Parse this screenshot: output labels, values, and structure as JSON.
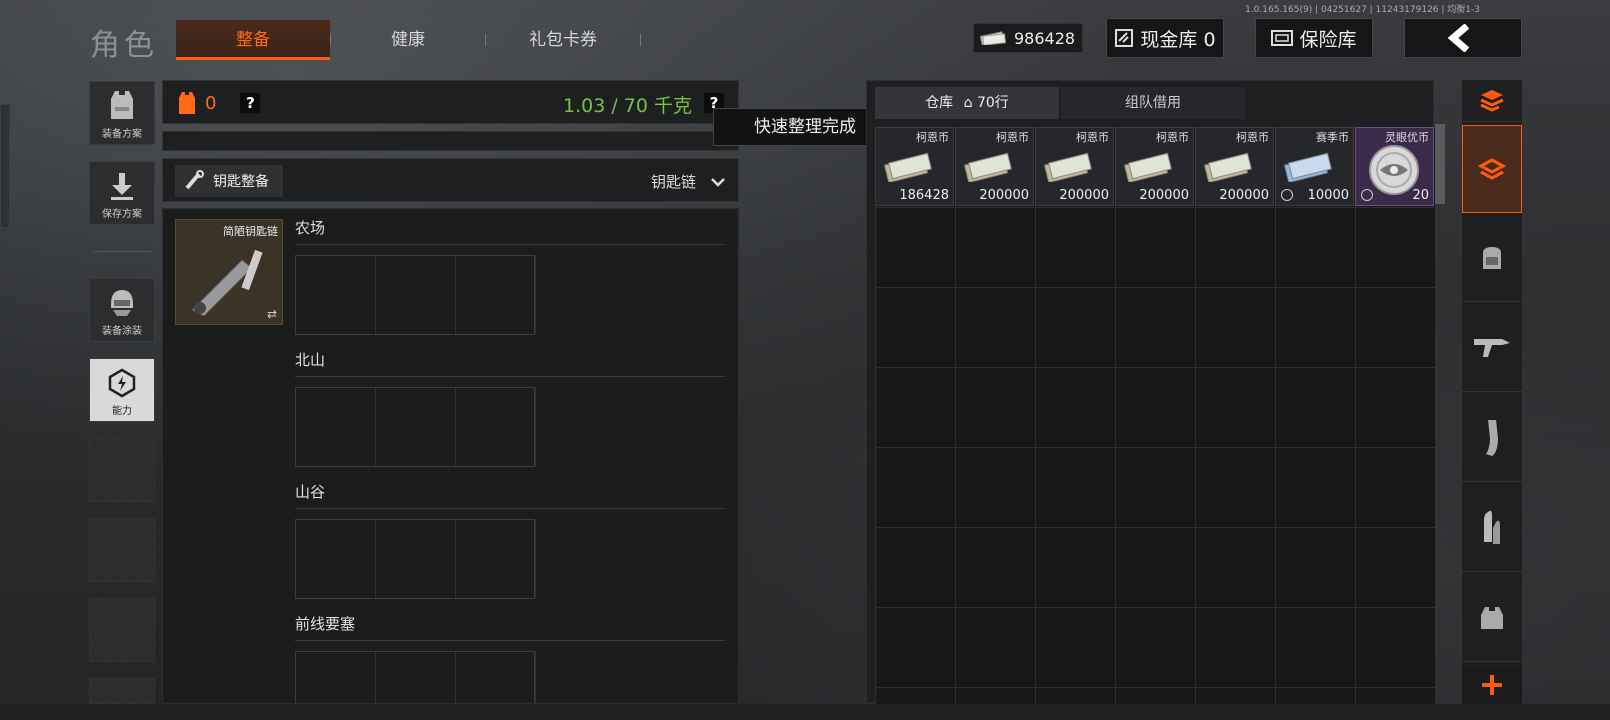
{
  "version": "1.0.165.165(9) | 04251627 | 11243179126 | 均衡1-3",
  "page_title": "角色",
  "tabs": [
    {
      "label": "整备",
      "active": true
    },
    {
      "label": "健康",
      "active": false
    },
    {
      "label": "礼包卡券",
      "active": false
    }
  ],
  "header": {
    "money": "986428",
    "cash_vault": "现金库 0",
    "safe_vault": "保险库"
  },
  "sidebar": {
    "items": [
      {
        "label": "装备方案",
        "icon": "vest-icon"
      },
      {
        "label": "保存方案",
        "icon": "download-icon"
      },
      {
        "label": "装备涂装",
        "icon": "helmet-icon"
      },
      {
        "label": "能力",
        "icon": "ability-icon",
        "active": true
      }
    ]
  },
  "gear": {
    "vest_count": "0",
    "help": "?",
    "weight": "1.03 / 70 千克",
    "weight_help": "?"
  },
  "tooltip": "快速整理完成",
  "keys": {
    "tab_label": "钥匙整备",
    "selector": "钥匙链",
    "keychain_label": "简陋钥匙链",
    "zones": [
      "农场",
      "北山",
      "山谷",
      "前线要塞"
    ]
  },
  "warehouse": {
    "tab_label": "仓库",
    "rows": "70行",
    "team_tab": "组队借用",
    "items": [
      {
        "name": "柯恩币",
        "qty": "186428"
      },
      {
        "name": "柯恩币",
        "qty": "200000"
      },
      {
        "name": "柯恩币",
        "qty": "200000"
      },
      {
        "name": "柯恩币",
        "qty": "200000"
      },
      {
        "name": "柯恩币",
        "qty": "200000"
      },
      {
        "name": "赛季币",
        "qty": "10000"
      },
      {
        "name": "灵眼优币",
        "qty": "20"
      }
    ]
  },
  "categories": [
    "all-items-icon",
    "warehouse-icon",
    "backpack-icon",
    "rifle-icon",
    "magazine-icon",
    "ammo-icon",
    "armor-icon"
  ],
  "colors": {
    "accent": "#ff5a10",
    "weight_green": "#7ac143",
    "rare_purple": "#3b2a4a"
  }
}
